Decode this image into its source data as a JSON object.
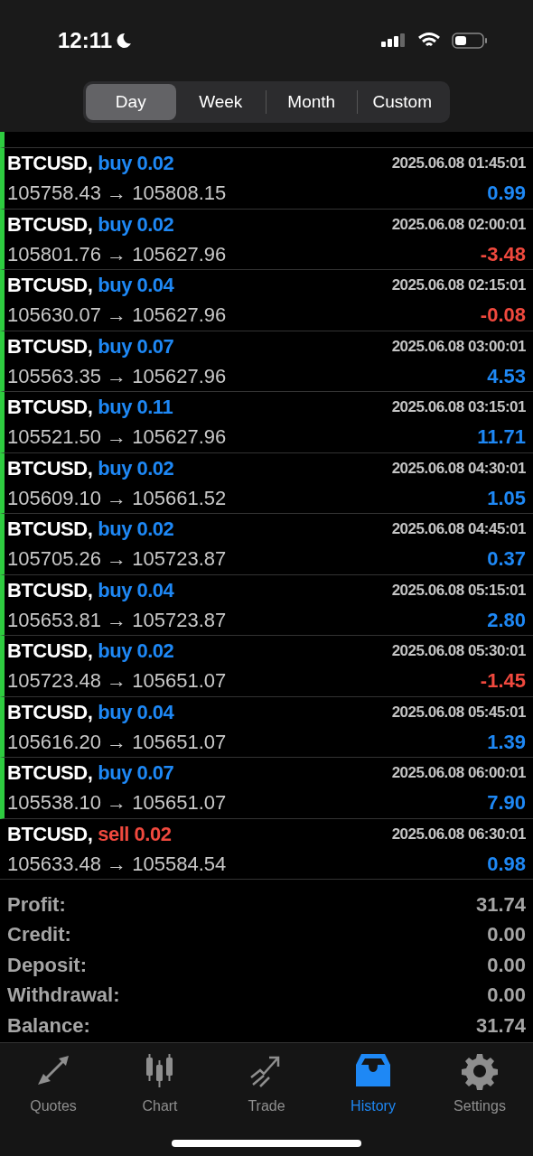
{
  "status_bar": {
    "time": "12:11"
  },
  "periods": [
    {
      "label": "Day",
      "selected": true
    },
    {
      "label": "Week",
      "selected": false
    },
    {
      "label": "Month",
      "selected": false
    },
    {
      "label": "Custom",
      "selected": false
    }
  ],
  "deals": [
    {
      "symbol": "BTCUSD,",
      "kind": "buy",
      "volume": "buy 0.02",
      "time": "2025.06.08 01:45:01",
      "prices": "105758.43 → 105808.15",
      "profit": "0.99",
      "loss": false
    },
    {
      "symbol": "BTCUSD,",
      "kind": "buy",
      "volume": "buy 0.02",
      "time": "2025.06.08 02:00:01",
      "prices": "105801.76 → 105627.96",
      "profit": "-3.48",
      "loss": true
    },
    {
      "symbol": "BTCUSD,",
      "kind": "buy",
      "volume": "buy 0.04",
      "time": "2025.06.08 02:15:01",
      "prices": "105630.07 → 105627.96",
      "profit": "-0.08",
      "loss": true
    },
    {
      "symbol": "BTCUSD,",
      "kind": "buy",
      "volume": "buy 0.07",
      "time": "2025.06.08 03:00:01",
      "prices": "105563.35 → 105627.96",
      "profit": "4.53",
      "loss": false
    },
    {
      "symbol": "BTCUSD,",
      "kind": "buy",
      "volume": "buy 0.11",
      "time": "2025.06.08 03:15:01",
      "prices": "105521.50 → 105627.96",
      "profit": "11.71",
      "loss": false
    },
    {
      "symbol": "BTCUSD,",
      "kind": "buy",
      "volume": "buy 0.02",
      "time": "2025.06.08 04:30:01",
      "prices": "105609.10 → 105661.52",
      "profit": "1.05",
      "loss": false
    },
    {
      "symbol": "BTCUSD,",
      "kind": "buy",
      "volume": "buy 0.02",
      "time": "2025.06.08 04:45:01",
      "prices": "105705.26 → 105723.87",
      "profit": "0.37",
      "loss": false
    },
    {
      "symbol": "BTCUSD,",
      "kind": "buy",
      "volume": "buy 0.04",
      "time": "2025.06.08 05:15:01",
      "prices": "105653.81 → 105723.87",
      "profit": "2.80",
      "loss": false
    },
    {
      "symbol": "BTCUSD,",
      "kind": "buy",
      "volume": "buy 0.02",
      "time": "2025.06.08 05:30:01",
      "prices": "105723.48 → 105651.07",
      "profit": "-1.45",
      "loss": true
    },
    {
      "symbol": "BTCUSD,",
      "kind": "buy",
      "volume": "buy 0.04",
      "time": "2025.06.08 05:45:01",
      "prices": "105616.20 → 105651.07",
      "profit": "1.39",
      "loss": false
    },
    {
      "symbol": "BTCUSD,",
      "kind": "buy",
      "volume": "buy 0.07",
      "time": "2025.06.08 06:00:01",
      "prices": "105538.10 → 105651.07",
      "profit": "7.90",
      "loss": false
    },
    {
      "symbol": "BTCUSD,",
      "kind": "sell",
      "volume": "sell 0.02",
      "time": "2025.06.08 06:30:01",
      "prices": "105633.48 → 105584.54",
      "profit": "0.98",
      "loss": false
    }
  ],
  "summary": [
    {
      "label": "Profit:",
      "value": "31.74"
    },
    {
      "label": "Credit:",
      "value": "0.00"
    },
    {
      "label": "Deposit:",
      "value": "0.00"
    },
    {
      "label": "Withdrawal:",
      "value": "0.00"
    },
    {
      "label": "Balance:",
      "value": "31.74"
    }
  ],
  "tab_bar": [
    {
      "label": "Quotes",
      "kind": "quotes",
      "selected": false
    },
    {
      "label": "Chart",
      "kind": "chart",
      "selected": false
    },
    {
      "label": "Trade",
      "kind": "trade",
      "selected": false
    },
    {
      "label": "History",
      "kind": "history",
      "selected": true
    },
    {
      "label": "Settings",
      "kind": "settings",
      "selected": false
    }
  ]
}
